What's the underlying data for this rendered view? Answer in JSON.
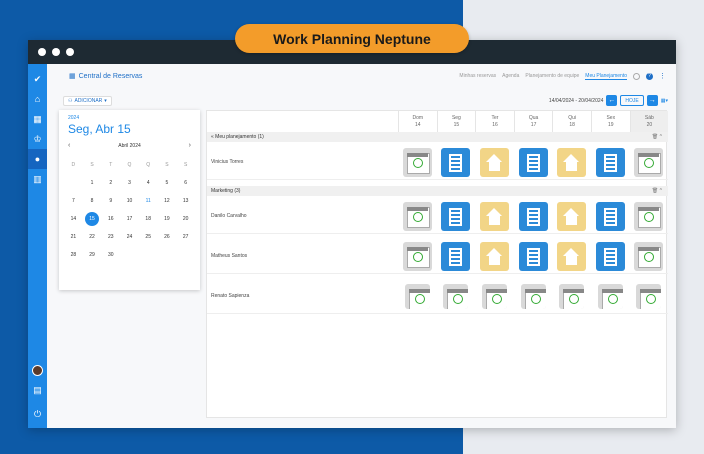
{
  "banner": "Work Planning Neptune",
  "header": {
    "title": "Central de Reservas"
  },
  "tabs": [
    "Minhas reservas",
    "Agenda",
    "Planejamento de equipe",
    "Meu Planejamento"
  ],
  "toolbar": {
    "add_label": "ADICIONAR",
    "date_range": "14/04/2024 - 20/04/2024",
    "today_label": "HOJE"
  },
  "calendar": {
    "year": "2024",
    "selected_label": "Seg, Abr 15",
    "month_label": "Abril 2024",
    "weekdays": [
      "D",
      "S",
      "T",
      "Q",
      "Q",
      "S",
      "S"
    ],
    "weeks": [
      [
        "",
        "1",
        "2",
        "3",
        "4",
        "5",
        "6"
      ],
      [
        "7",
        "8",
        "9",
        "10",
        "11",
        "12",
        "13"
      ],
      [
        "14",
        "15",
        "16",
        "17",
        "18",
        "19",
        "20"
      ],
      [
        "21",
        "22",
        "23",
        "24",
        "25",
        "26",
        "27"
      ],
      [
        "28",
        "29",
        "30",
        "",
        "",
        "",
        ""
      ]
    ],
    "selected_day": "15",
    "highlight_day": "11"
  },
  "days": [
    {
      "name": "Dom",
      "num": "14"
    },
    {
      "name": "Seg",
      "num": "15"
    },
    {
      "name": "Ter",
      "num": "16"
    },
    {
      "name": "Qua",
      "num": "17"
    },
    {
      "name": "Qui",
      "num": "18"
    },
    {
      "name": "Sex",
      "num": "19"
    },
    {
      "name": "Sáb",
      "num": "20"
    }
  ],
  "groups": [
    {
      "label": "« Meu planejamento (1)",
      "rows": [
        {
          "name": "Vinicius Torres",
          "tiles": [
            "off",
            "work",
            "home",
            "work",
            "home",
            "work",
            "off"
          ]
        }
      ]
    },
    {
      "label": "Marketing (3)",
      "rows": [
        {
          "name": "Danilo Carvalho",
          "tiles": [
            "off",
            "work",
            "home",
            "work",
            "home",
            "work",
            "off"
          ]
        },
        {
          "name": "Matheus Santos",
          "tiles": [
            "off",
            "work",
            "home",
            "work",
            "home",
            "work",
            "off"
          ]
        },
        {
          "name": "Renato Sapienza",
          "tiles": [
            "off",
            "off",
            "off",
            "off",
            "off",
            "off",
            "off"
          ]
        }
      ]
    }
  ]
}
